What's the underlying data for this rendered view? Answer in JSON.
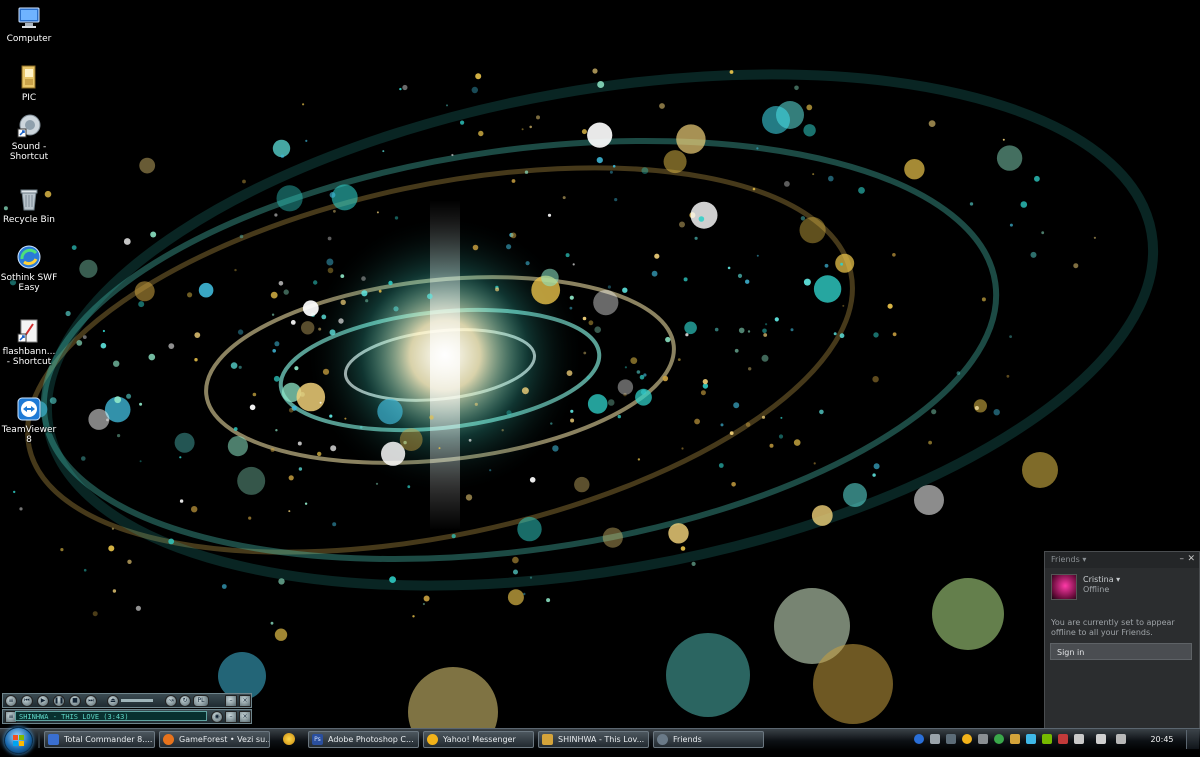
{
  "desktop": {
    "icons": [
      {
        "label": "Computer",
        "icon": "computer-icon"
      },
      {
        "label": "PIC",
        "icon": "folder-icon"
      },
      {
        "label": "Sound - Shortcut",
        "icon": "sound-shortcut-icon"
      },
      {
        "label": "Recycle Bin",
        "icon": "recycle-bin-icon"
      },
      {
        "label": "Sothink SWF Easy",
        "icon": "sothink-swf-easy-icon"
      },
      {
        "label": "flashbann... - Shortcut",
        "icon": "flash-document-icon"
      },
      {
        "label": "TeamViewer 8",
        "icon": "teamviewer-icon"
      }
    ]
  },
  "media_player": {
    "now_playing": "SHINHWA - THIS LOVE (3:43)"
  },
  "friends": {
    "title": "Friends ▾",
    "username": "Cristina",
    "status": "Offline",
    "message": "You are currently set to appear offline to all your Friends.",
    "signin_label": "Sign in"
  },
  "taskbar": {
    "buttons": [
      {
        "label": "Total Commander 8....",
        "icon": "total-commander-icon",
        "color": "#3a6fd0"
      },
      {
        "label": "GameForest • Vezi su...",
        "icon": "firefox-icon",
        "color": "#e8731c"
      },
      {
        "label": "Adobe Photoshop C...",
        "icon": "photoshop-icon",
        "color": "#2a4f9e"
      },
      {
        "label": "Yahoo! Messenger",
        "icon": "yahoo-messenger-icon",
        "color": "#f2b21a"
      },
      {
        "label": "SHINHWA - This Lov...",
        "icon": "winamp-icon",
        "color": "#d4a33a"
      },
      {
        "label": "Friends",
        "icon": "steam-icon",
        "color": "#6a7a88"
      }
    ],
    "clock": "20:45"
  }
}
